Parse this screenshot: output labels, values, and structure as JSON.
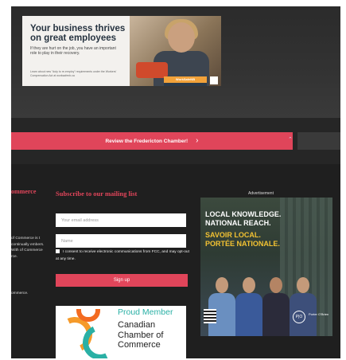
{
  "top_ad": {
    "headline": "Your business thrives on great employees",
    "subtext": "If they are hurt on the job, you have an important role to play in their recovery.",
    "fine_print": "Learn about new \"duty to re-employ\" requirements under the Workers' Compensation Act at worksafenb.ca",
    "badge": "WorkSafeNB"
  },
  "cta": {
    "label": "Review the Fredericton Chamber!",
    "arrow": "›"
  },
  "footer": {
    "left_heading": "ommerce",
    "left_text": "of Commerce is t continually embers. With of Commerce rce.",
    "left_text2": "ommerce."
  },
  "subscribe": {
    "title": "Subscribe to our mailing list",
    "email_placeholder": "Your email address",
    "name_placeholder": "Name",
    "consent": "I consent to receive electronic communications from FCC, and may opt-out at any time.",
    "signup_label": "Sign up"
  },
  "member_badge": {
    "proud": "Proud Member",
    "name": "Canadian Chamber of Commerce"
  },
  "right_ad": {
    "label": "Advertisement",
    "line1": "LOCAL KNOWLEDGE.",
    "line2": "NATIONAL REACH.",
    "line3": "SAVOIR LOCAL.",
    "line4": "PORTÉE NATIONALE.",
    "logo": "P|O",
    "logo_text": "Porter O'Brien"
  },
  "colors": {
    "accent": "#e0455a",
    "dark_bg": "#1f1f1f",
    "teal": "#2ab0a5",
    "orange": "#f59a2a"
  }
}
